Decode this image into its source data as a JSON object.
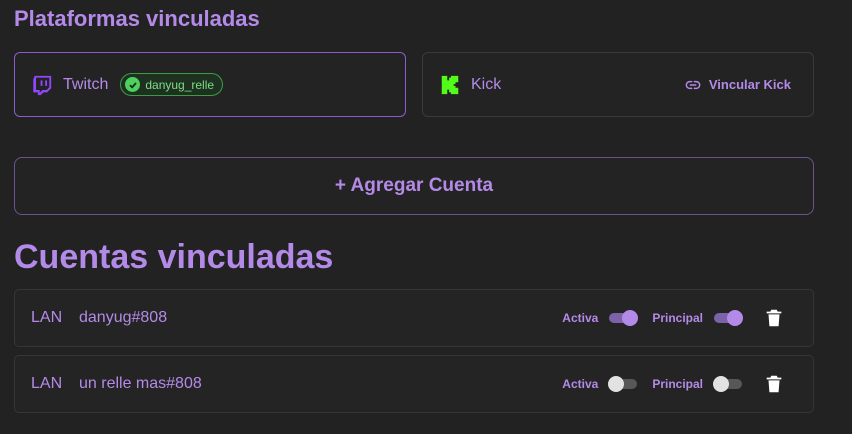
{
  "platforms": {
    "title": "Plataformas vinculadas",
    "twitch": {
      "name": "Twitch",
      "linked_user": "danyug_relle",
      "icon": "twitch-icon",
      "brand_color": "#9146FF"
    },
    "kick": {
      "name": "Kick",
      "action_label": "Vincular Kick",
      "icon": "kick-icon",
      "brand_color": "#53FC18"
    }
  },
  "add_account": {
    "label": "+ Agregar Cuenta"
  },
  "accounts": {
    "title": "Cuentas vinculadas",
    "rows": [
      {
        "region": "LAN",
        "riot_id": "danyug#808",
        "active_label": "Activa",
        "active": true,
        "principal_label": "Principal",
        "principal": true
      },
      {
        "region": "LAN",
        "riot_id": "un relle mas#808",
        "active_label": "Activa",
        "active": false,
        "principal_label": "Principal",
        "principal": false
      }
    ]
  },
  "colors": {
    "accent": "#B48AE8",
    "background": "#222222",
    "linked_green": "#4FD160"
  }
}
